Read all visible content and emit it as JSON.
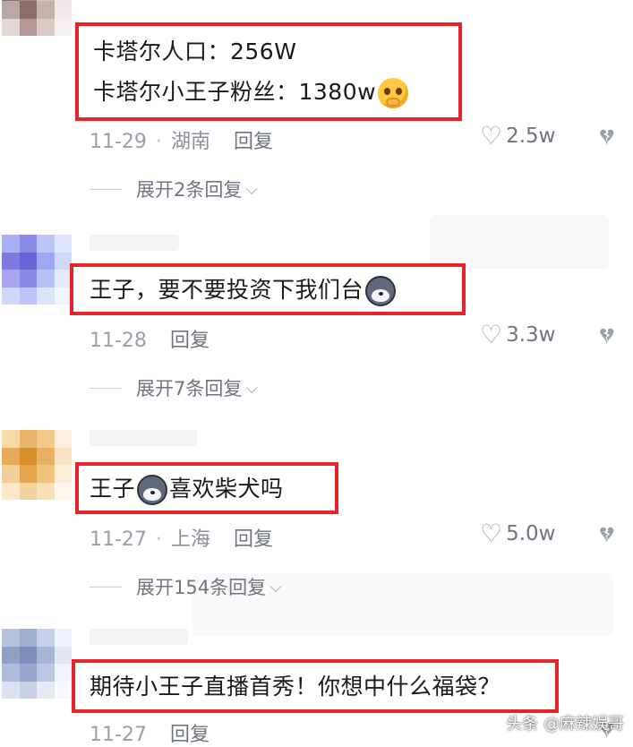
{
  "comments": [
    {
      "lines": [
        "卡塔尔人口：256W",
        "卡塔尔小王子粉丝：1380w"
      ],
      "emoji": "shy-face-emoji",
      "date": "11-29",
      "location": "湖南",
      "reply_label": "回复",
      "likes": "2.5w",
      "expand_label": "展开2条回复"
    },
    {
      "lines": [
        "王子，要不要投资下我们台"
      ],
      "emoji": "husky-dog-emoji",
      "date": "11-28",
      "location": "",
      "reply_label": "回复",
      "likes": "3.3w",
      "expand_label": "展开7条回复"
    },
    {
      "line_before": "王子",
      "emoji": "husky-dog-emoji",
      "line_after": "喜欢柴犬吗",
      "date": "11-27",
      "location": "上海",
      "reply_label": "回复",
      "likes": "5.0w",
      "expand_label": "展开154条回复"
    },
    {
      "lines": [
        "期待小王子直播首秀！你想中什么福袋？"
      ],
      "date": "11-27",
      "location": "",
      "reply_label": "回复"
    }
  ],
  "watermark": "头条 @麻辣娱哥",
  "colors": {
    "highlight_border": "#e8232a",
    "meta_text": "#8a8f99",
    "icon_gray": "#9aa0aa"
  },
  "icons": {
    "like": "heart-outline-icon",
    "dislike": "broken-heart-icon",
    "expand": "chevron-down-icon"
  }
}
